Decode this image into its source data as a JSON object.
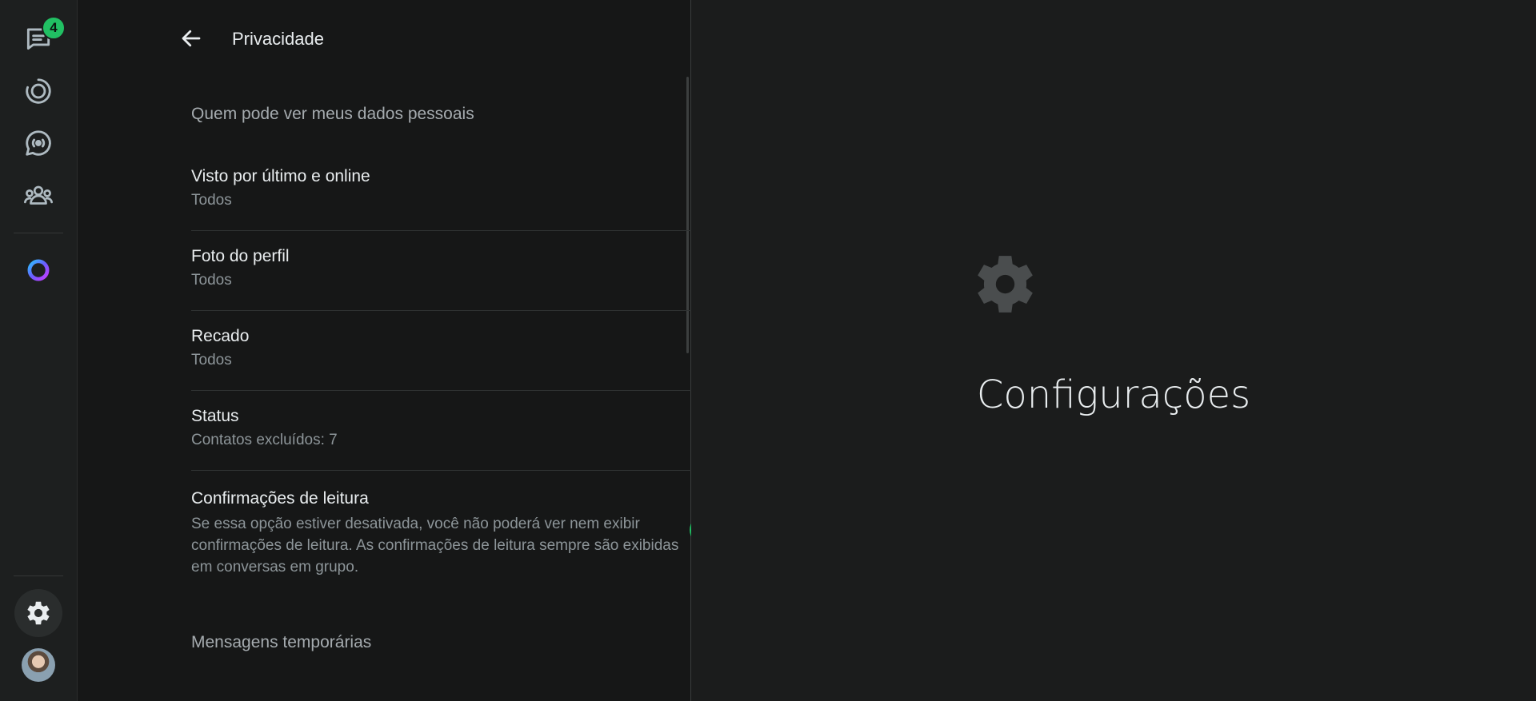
{
  "rail": {
    "chats_badge": "4",
    "icons": [
      "chats-icon",
      "status-icon",
      "channels-icon",
      "communities-icon",
      "meta-ai-icon",
      "settings-icon",
      "profile-avatar"
    ]
  },
  "panel": {
    "title": "Privacidade",
    "section_personal": "Quem pode ver meus dados pessoais",
    "items": [
      {
        "title": "Visto por último e online",
        "value": "Todos"
      },
      {
        "title": "Foto do perfil",
        "value": "Todos"
      },
      {
        "title": "Recado",
        "value": "Todos"
      },
      {
        "title": "Status",
        "value": "Contatos excluídos: 7"
      }
    ],
    "read_receipts": {
      "title": "Confirmações de leitura",
      "description": "Se essa opção estiver desativada, você não poderá ver nem exibir confirmações de leitura. As confirmações de leitura sempre são exibidas em conversas em grupo.",
      "enabled": true
    },
    "section_temporary": "Mensagens temporárias"
  },
  "main": {
    "title": "Configurações",
    "icon": "gear-icon"
  },
  "colors": {
    "accent": "#21c063",
    "background": "#161717",
    "rail": "#1d1f1f"
  }
}
